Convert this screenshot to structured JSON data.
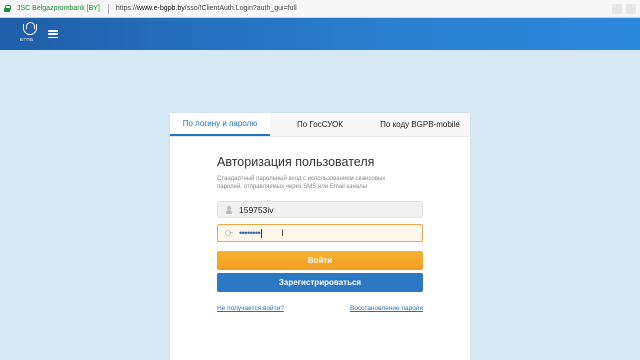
{
  "browser": {
    "site_name": "JSC Belgazprombank [BY]",
    "url_prefix": "https://",
    "url_host": "www.e-bgpb.by",
    "url_path": "/sso/!ClientAuth.Login?auth_gui=full"
  },
  "header": {
    "logo_text": "БГПБ"
  },
  "tabs": [
    {
      "label": "По логину и паролю",
      "active": true
    },
    {
      "label": "По ГосСУОК",
      "active": false
    },
    {
      "label": "По коду BGPB-mobile",
      "active": false
    }
  ],
  "form": {
    "title": "Авторизация пользователя",
    "description": "Стандартный парольный вход с использованием сеансовых паролей, отправляемых через SMS или Email каналы",
    "login_value": "159753iv",
    "password_mask": "••••••••",
    "login_button": "Войти",
    "register_button": "Зарегистрироваться",
    "help_link": "Не получается войти?",
    "restore_link": "Восстановление пароля"
  },
  "colors": {
    "accent": "#1f73c0",
    "login_button": "#f5a623",
    "register_button": "#2d78c4",
    "page_bg": "#d6e8f4"
  }
}
